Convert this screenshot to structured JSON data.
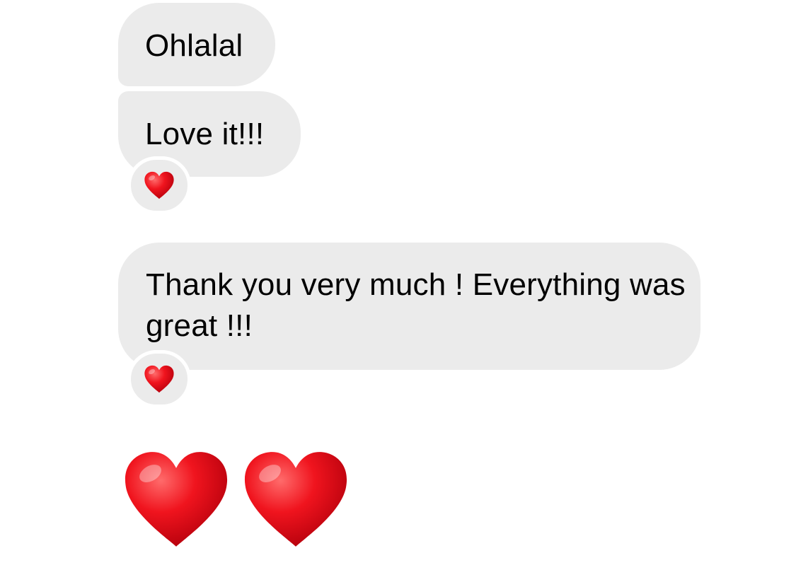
{
  "messages": [
    {
      "text": "Ohlalal",
      "reaction": null
    },
    {
      "text": "Love it!!!",
      "reaction": "red-heart-icon"
    },
    {
      "text": "Thank you very much ! Everything was great !!!",
      "reaction": "red-heart-icon"
    }
  ],
  "big_emoji_message": [
    "red-heart-icon",
    "red-heart-icon"
  ],
  "colors": {
    "bubble_background": "#ebebeb",
    "text": "#000000",
    "heart": "#e8141e",
    "page_background": "#ffffff"
  }
}
